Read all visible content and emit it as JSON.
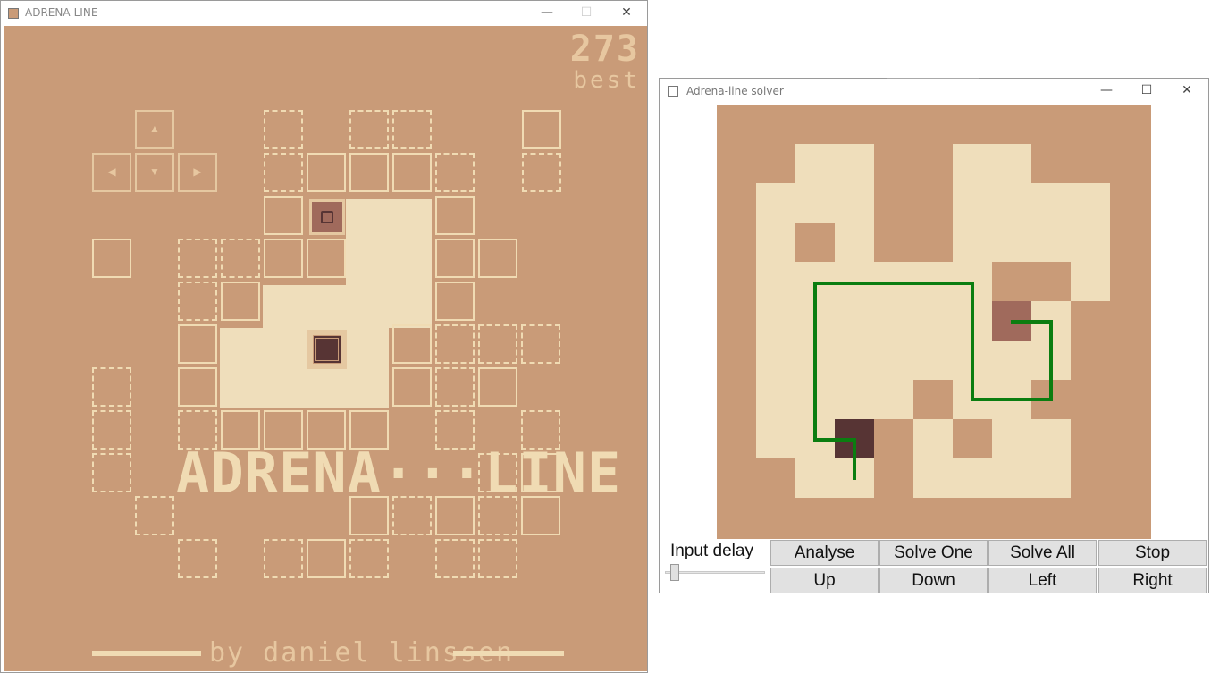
{
  "game_window": {
    "title": "ADRENA-LINE",
    "minimize": "—",
    "maximize": "☐",
    "close": "✕"
  },
  "game": {
    "score": "273",
    "best_label": "best",
    "logo": "ADRENA···LINE",
    "credit": "by daniel linssen",
    "arrow_up": "▲",
    "arrow_down": "▼",
    "arrow_left": "◀",
    "arrow_right": "▶"
  },
  "solver_window": {
    "title": "Adrena-line solver",
    "minimize": "—",
    "maximize": "☐",
    "close": "✕"
  },
  "solver": {
    "input_delay_label": "Input delay",
    "input_delay_value": 0.05,
    "buttons": {
      "analyse": "Analyse",
      "solve_one": "Solve One",
      "solve_all": "Solve All",
      "stop": "Stop",
      "up": "Up",
      "down": "Down",
      "left": "Left",
      "right": "Right"
    },
    "colors": {
      "wall": "#c99b78",
      "floor": "#efdebb",
      "start": "#a06a5c",
      "goal": "#573434",
      "path": "#0b7d10"
    }
  }
}
